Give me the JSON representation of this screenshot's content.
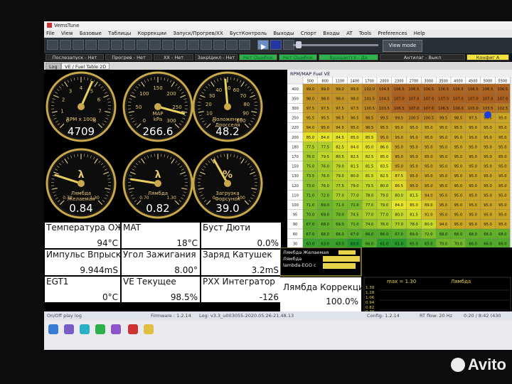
{
  "window": {
    "title": "VemsTune"
  },
  "menu": [
    "File",
    "View",
    "Базовые",
    "Таблицы",
    "Коррекции",
    "Запуск/Прогрев/ХХ",
    "БустКонтроль",
    "Выходы",
    "Спорт",
    "Входы",
    "AT",
    "Tools",
    "Preferences",
    "Help"
  ],
  "toolbar": {
    "view_mode": "View mode"
  },
  "status": [
    {
      "text": "Послезапуск - Нет",
      "style": "dark"
    },
    {
      "text": "Прогрев - Нет",
      "style": "dark"
    },
    {
      "text": "ХХ - Нет",
      "style": "dark"
    },
    {
      "text": "ЗакрЦикл - Нет",
      "style": "dark"
    },
    {
      "text": "Нет Ошибок",
      "style": "green"
    },
    {
      "text": "Нет Ошибок",
      "style": "green"
    },
    {
      "text": "Вращается - Да",
      "style": "green"
    },
    {
      "text": "Антилаг - Выкл",
      "style": "dark"
    },
    {
      "text": "Конфиг А",
      "style": "yellow"
    }
  ],
  "tabs": [
    "Log",
    "VE / Fuel Table 2D"
  ],
  "gauges": [
    {
      "label": "RPM x 1000",
      "value": "4709",
      "min": 0,
      "max": 8,
      "reading": 4.709,
      "ticks": [
        "0",
        "1",
        "2",
        "3",
        "4",
        "5",
        "6",
        "7",
        "8"
      ]
    },
    {
      "label": "kPa",
      "sub": "MAP",
      "value": "266.6",
      "min": 0,
      "max": 300,
      "reading": 266.6,
      "ticks": [
        "0",
        "50",
        "100",
        "150",
        "200",
        "250",
        "300"
      ]
    },
    {
      "label": "Положение Дросселя",
      "value": "48.2",
      "min": 0,
      "max": 100,
      "reading": 48.2,
      "ticks": [
        "0",
        "10",
        "20",
        "30",
        "40",
        "50",
        "60",
        "70",
        "80",
        "90",
        "100"
      ]
    },
    {
      "label": "Лямбда Желаемая",
      "sym": "λ",
      "value": "0.84",
      "min": 0.7,
      "max": 1.3,
      "reading": 0.84,
      "ticks": [
        "0.70",
        "1.30"
      ]
    },
    {
      "label": "Лямбда",
      "sym": "λ",
      "value": "0.82",
      "min": 0.7,
      "max": 1.3,
      "reading": 0.82,
      "ticks": [
        "0.70",
        "1.30"
      ]
    },
    {
      "label": "Загрузка Форсунок",
      "sym": "%",
      "value": "39.0",
      "min": 0,
      "max": 100,
      "reading": 39.0,
      "ticks": [
        "0",
        "100"
      ]
    }
  ],
  "readouts": [
    {
      "label": "Температура ОЖ",
      "value": "94°C"
    },
    {
      "label": "MAT",
      "value": "18°C"
    },
    {
      "label": "Буст Дюти",
      "value": "0.0%"
    },
    {
      "label": "Импульс Впрыска",
      "value": "9.944mS"
    },
    {
      "label": "Угол Зажигания",
      "value": "8.00°"
    },
    {
      "label": "Заряд Катушек",
      "value": "3.2mS"
    },
    {
      "label": "EGT1",
      "value": "0°C"
    },
    {
      "label": "VE Текущее",
      "value": "98.5%"
    },
    {
      "label": "PXX Интегратор",
      "value": "-126"
    },
    {
      "label": "Лямбда Коррекци",
      "value": "100.0%"
    }
  ],
  "ve_table": {
    "title": "RPM/MAP Fuel VE",
    "cols": [
      "500",
      "800",
      "1100",
      "1400",
      "1700",
      "2000",
      "2300",
      "2700",
      "3000",
      "3500",
      "4000",
      "4500",
      "5000",
      "5500"
    ],
    "rows": [
      {
        "load": "400",
        "v": [
          "99.0",
          "99.0",
          "99.0",
          "99.0",
          "102.0",
          "104.5",
          "106.5",
          "106.5",
          "106.5",
          "106.5",
          "106.5",
          "106.5",
          "106.5",
          "106.5"
        ]
      },
      {
        "load": "350",
        "v": [
          "98.0",
          "98.0",
          "98.0",
          "98.0",
          "101.5",
          "104.5",
          "107.0",
          "107.0",
          "107.0",
          "107.0",
          "107.0",
          "107.0",
          "107.0",
          "107.0"
        ]
      },
      {
        "load": "300",
        "v": [
          "97.5",
          "97.5",
          "97.5",
          "97.5",
          "100.5",
          "103.5",
          "106.5",
          "107.0",
          "107.0",
          "106.5",
          "106.0",
          "105.0",
          "103.5",
          "102.5"
        ]
      },
      {
        "load": "250",
        "v": [
          "95.5",
          "95.5",
          "96.5",
          "96.5",
          "98.5",
          "99.5",
          "99.5",
          "100.5",
          "100.5",
          "99.5",
          "98.5",
          "97.5",
          "96.5",
          "95.0"
        ]
      },
      {
        "load": "220",
        "v": [
          "94.0",
          "95.0",
          "94.5",
          "95.0",
          "96.5",
          "95.5",
          "95.0",
          "95.0",
          "95.0",
          "95.0",
          "95.5",
          "95.0",
          "95.0",
          "95.0"
        ]
      },
      {
        "load": "200",
        "v": [
          "85.0",
          "84.0",
          "84.5",
          "85.0",
          "85.5",
          "95.0",
          "95.0",
          "95.0",
          "95.0",
          "95.0",
          "95.0",
          "95.0",
          "95.0",
          "95.0"
        ]
      },
      {
        "load": "180",
        "v": [
          "77.5",
          "77.5",
          "82.5",
          "84.0",
          "85.0",
          "86.0",
          "95.0",
          "95.0",
          "95.0",
          "95.0",
          "95.0",
          "95.0",
          "95.0",
          "95.0"
        ]
      },
      {
        "load": "170",
        "v": [
          "76.0",
          "79.5",
          "80.5",
          "82.5",
          "82.5",
          "85.0",
          "95.0",
          "95.0",
          "95.0",
          "95.0",
          "95.0",
          "95.0",
          "95.0",
          "95.0"
        ]
      },
      {
        "load": "150",
        "v": [
          "75.0",
          "76.0",
          "79.0",
          "81.5",
          "81.5",
          "83.5",
          "95.0",
          "95.0",
          "95.0",
          "95.0",
          "95.0",
          "95.0",
          "95.0",
          "95.0"
        ]
      },
      {
        "load": "130",
        "v": [
          "73.5",
          "76.0",
          "79.0",
          "80.0",
          "81.5",
          "82.5",
          "87.5",
          "95.0",
          "95.0",
          "95.0",
          "95.0",
          "95.0",
          "95.0",
          "95.0"
        ]
      },
      {
        "load": "120",
        "v": [
          "73.0",
          "76.0",
          "77.5",
          "79.0",
          "79.5",
          "80.0",
          "86.5",
          "95.0",
          "95.0",
          "95.0",
          "95.0",
          "95.0",
          "95.0",
          "95.0"
        ]
      },
      {
        "load": "110",
        "v": [
          "71.0",
          "72.0",
          "77.0",
          "77.0",
          "78.0",
          "79.0",
          "80.0",
          "81.5",
          "94.0",
          "95.0",
          "95.0",
          "95.0",
          "95.0",
          "95.0"
        ]
      },
      {
        "load": "100",
        "v": [
          "71.0",
          "69.0",
          "71.0",
          "71.0",
          "77.0",
          "79.0",
          "84.0",
          "85.0",
          "89.0",
          "95.0",
          "95.0",
          "95.0",
          "95.0",
          "95.0"
        ]
      },
      {
        "load": "95",
        "v": [
          "70.0",
          "69.0",
          "70.0",
          "74.5",
          "77.0",
          "77.0",
          "80.0",
          "81.5",
          "91.0",
          "95.0",
          "95.0",
          "95.0",
          "95.0",
          "95.0"
        ]
      },
      {
        "load": "90",
        "v": [
          "67.0",
          "68.0",
          "69.0",
          "71.0",
          "74.0",
          "76.0",
          "77.0",
          "78.0",
          "80.0",
          "94.0",
          "95.0",
          "95.0",
          "95.0",
          "95.0"
        ]
      },
      {
        "load": "60",
        "v": [
          "67.0",
          "68.0",
          "68.0",
          "67.0",
          "66.0",
          "66.0",
          "67.0",
          "69.0",
          "72.0",
          "68.0",
          "68.0",
          "68.0",
          "68.0",
          "68.0"
        ]
      },
      {
        "load": "30",
        "v": [
          "63.0",
          "63.0",
          "63.0",
          "60.0",
          "66.0",
          "61.0",
          "61.0",
          "65.0",
          "65.0",
          "70.0",
          "70.0",
          "66.0",
          "66.0",
          "66.0"
        ]
      },
      {
        "load": "20",
        "v": [
          "63.0",
          "63.0",
          "63.0",
          "60.0",
          "66.0",
          "61.0",
          "61.0",
          "65.0",
          "65.0",
          "70.0",
          "70.0",
          "66.0",
          "66.0",
          "66.0"
        ]
      }
    ]
  },
  "lambda_chart": {
    "legend": [
      "Лямбда Желаемая",
      "Лямбда",
      "lambda-EGO c"
    ],
    "max_label": "max = 1.30",
    "title": "Лямбда",
    "scale": [
      "1.30",
      "1.18",
      "1.06",
      "0.94",
      "0.82",
      "0.70"
    ]
  },
  "footer": {
    "log_label": "On/Off play log",
    "firmware": "Firmware : 1.2.14",
    "log_file": "Log: v3.3_u003055-2020.05.26-21.48.13",
    "config": "Config: 1.2.14",
    "rt_flow": "RT flow: 20 Hz",
    "time": "0:20 / 8:42 (430"
  },
  "watermark": "Avito",
  "colors": {
    "accent_green": "#2db34a",
    "accent_yellow": "#f2e23a",
    "gauge_gold": "#e0c060"
  }
}
